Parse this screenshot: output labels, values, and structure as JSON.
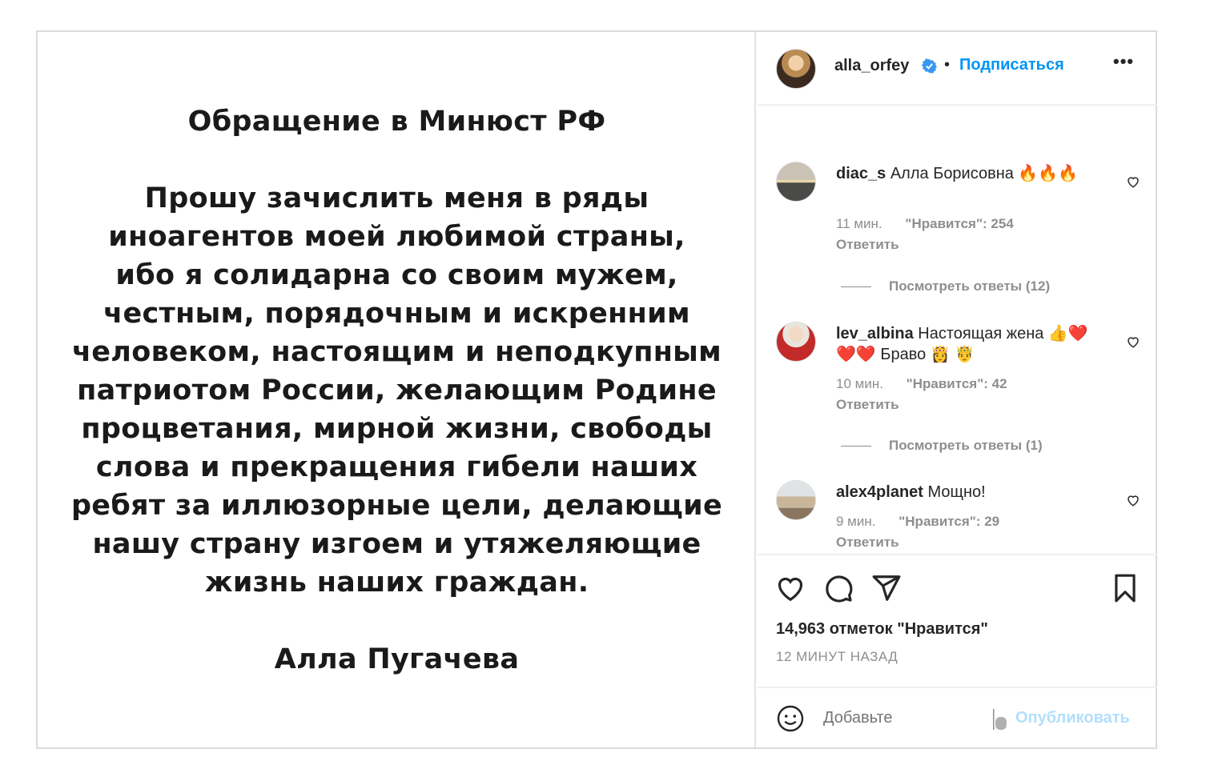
{
  "post": {
    "title": "Обращение в Минюст РФ",
    "body": "Прошу зачислить меня в ряды\nиноагентов моей любимой страны,\nибо я солидарна со своим мужем,\nчестным, порядочным и искренним\nчеловеком, настоящим и неподкупным\nпатриотом России, желающим Родине\nпроцветания, мирной жизни, свободы\nслова и прекращения гибели наших\nребят за иллюзорные цели, делающие\nнашу страну изгоем и утяжеляющие\nжизнь наших граждан.",
    "signature": "Алла Пугачева"
  },
  "header": {
    "username": "alla_orfey",
    "separator": "•",
    "follow_label": "Подписаться",
    "more_label": "•••"
  },
  "comments": [
    {
      "username": "diac_s",
      "text": "Алла Борисовна 🔥🔥🔥",
      "time": "11 мин.",
      "likes": "\"Нравится\": 254",
      "reply_label": "Ответить",
      "view_replies": "Посмотреть ответы (12)"
    },
    {
      "username": "lev_albina",
      "text": "Настоящая жена 👍❤️❤️❤️ Браво 👸 🤴",
      "time": "10 мин.",
      "likes": "\"Нравится\": 42",
      "reply_label": "Ответить",
      "view_replies": "Посмотреть ответы (1)"
    },
    {
      "username": "alex4planet",
      "text": "Мощно!",
      "time": "9 мин.",
      "likes": "\"Нравится\": 29",
      "reply_label": "Ответить"
    }
  ],
  "footer": {
    "likes_count": "14,963 отметок \"Нравится\"",
    "time_ago": "12 МИНУТ НАЗАД",
    "add_placeholder": "Добавьте",
    "publish_label": "Опубликовать"
  },
  "icons": {
    "heart": "heart-icon",
    "comment": "comment-icon",
    "share": "share-icon",
    "save": "bookmark-icon",
    "emoji": "emoji-icon",
    "verified": "verified-badge-icon"
  },
  "colors": {
    "accent": "#0095f6",
    "publish_disabled": "#b2dffc",
    "muted": "#8e8e8e",
    "text": "#262626"
  }
}
